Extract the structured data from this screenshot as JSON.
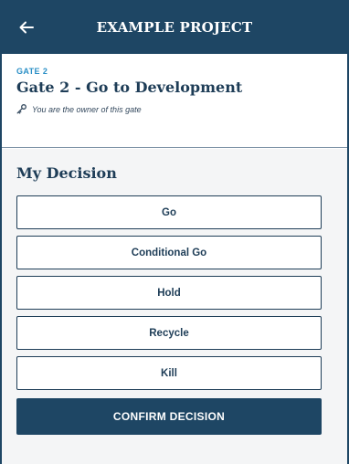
{
  "header": {
    "title": "EXAMPLE PROJECT",
    "back_icon": "arrow-left-icon"
  },
  "gate": {
    "kicker": "GATE 2",
    "title": "Gate 2 - Go to Development",
    "owner_icon": "key-icon",
    "owner_note": "You are the owner of this gate"
  },
  "decision": {
    "title": "My Decision",
    "options": [
      {
        "label": "Go"
      },
      {
        "label": "Conditional Go"
      },
      {
        "label": "Hold"
      },
      {
        "label": "Recycle"
      },
      {
        "label": "Kill"
      }
    ],
    "confirm_label": "CONFIRM DECISION"
  },
  "colors": {
    "brand_navy": "#1e4664",
    "text_navy": "#1e3d57",
    "kicker_blue": "#2a8fc6",
    "section_bg": "#f4f5f6"
  }
}
